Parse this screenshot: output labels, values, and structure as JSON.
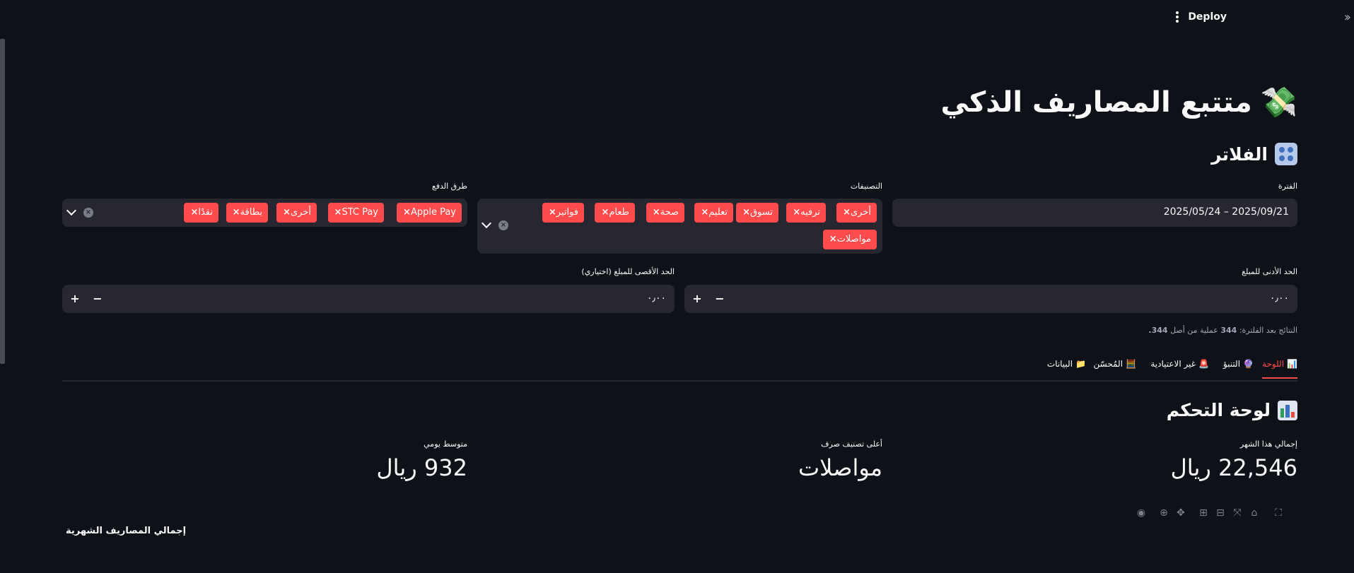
{
  "topbar": {
    "deploy_label": "Deploy"
  },
  "app": {
    "title": "متتبع المصاريف الذكي",
    "title_emoji": "💸"
  },
  "filters": {
    "section_title": "الفلاتر",
    "period": {
      "label": "الفترة",
      "value": "2025/05/24 – 2025/09/21"
    },
    "categories": {
      "label": "التصنيفات",
      "tags": [
        "أخرى",
        "ترفيه",
        "تسوق",
        "تعليم",
        "صحة",
        "طعام",
        "فواتير",
        "مواصلات"
      ]
    },
    "payment": {
      "label": "طرق الدفع",
      "tags": [
        "Apple Pay",
        "STC Pay",
        "أخرى",
        "بطاقة",
        "نقدًا"
      ]
    },
    "min_amount": {
      "label": "الحد الأدنى للمبلغ",
      "value": "٠٫٠٠"
    },
    "max_amount": {
      "label": "الحد الأقصى للمبلغ (اختياري)",
      "value": "٠٫٠٠"
    },
    "result_caption_prefix": "النتائج بعد الفلترة:",
    "result_count": "344",
    "result_caption_mid": "عملية من أصل",
    "result_total": "344."
  },
  "tabs": [
    {
      "label": "اللوحة",
      "icon": "📊"
    },
    {
      "label": "التنبؤ",
      "icon": "🔮"
    },
    {
      "label": "غير الاعتيادية",
      "icon": "🚨"
    },
    {
      "label": "المُحسّن",
      "icon": "🧮"
    },
    {
      "label": "البيانات",
      "icon": "📁"
    }
  ],
  "dashboard": {
    "title": "لوحة التحكم",
    "metrics": [
      {
        "label": "إجمالي هذا الشهر",
        "value": "22,546 ريال"
      },
      {
        "label": "أعلى تصنيف صرف",
        "value": "مواصلات"
      },
      {
        "label": "متوسط يومي",
        "value": "932 ريال"
      }
    ],
    "chart_title": "إجمالي المصاريف الشهرية"
  },
  "accent_color": "#ff4b4b",
  "background_color": "#0e1117"
}
